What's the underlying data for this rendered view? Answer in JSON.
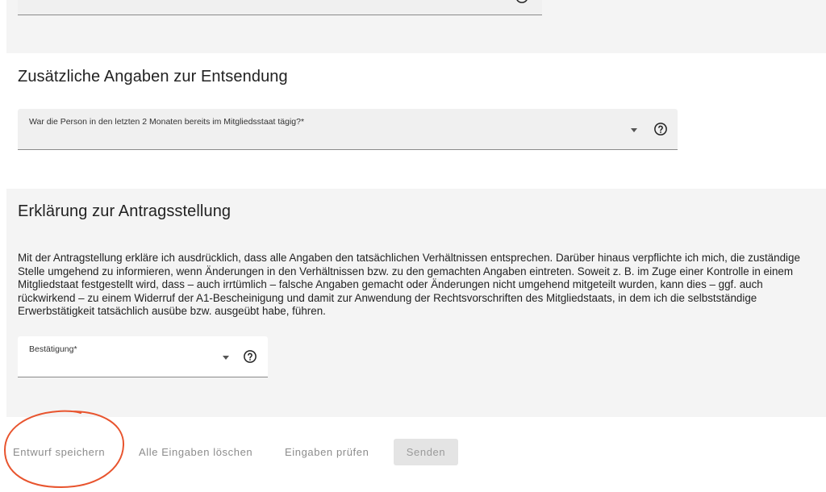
{
  "sections": {
    "entsendung": {
      "title": "Zusätzliche Angaben zur Entsendung",
      "field_label": "War die Person in den letzten 2 Monaten bereits im Mitgliedsstaat tägig?*"
    },
    "erklaerung": {
      "title": "Erklärung zur Antragsstellung",
      "text": "Mit der Antragstellung erkläre ich ausdrücklich, dass alle Angaben den tatsächlichen Verhältnissen entsprechen. Darüber hinaus verpflichte ich mich, die zuständige Stelle umgehend zu informieren, wenn Änderungen in den Verhältnissen bzw. zu den gemachten Angaben eintreten. Soweit z. B. im Zuge einer Kontrolle in einem Mitgliedstaat festgestellt wird, dass – auch irrtümlich – falsche Angaben gemacht oder Änderungen nicht umgehend mitgeteilt wurden, kann dies – ggf. auch rückwirkend – zu einem Widerruf der A1-Bescheinigung und damit zur Anwendung der Rechtsvorschriften des Mitgliedstaats, in dem ich die selbstständige Erwerbstätigkeit tatsächlich ausübe bzw. ausgeübt habe, führen.",
      "field_label": "Bestätigung*"
    }
  },
  "actions": {
    "draft": "Entwurf speichern",
    "clear": "Alle Eingaben löschen",
    "check": "Eingaben prüfen",
    "send": "Senden"
  },
  "icons": {
    "help": "help-circle-icon",
    "dropdown": "caret-down-icon"
  },
  "colors": {
    "section_bg": "#f4f4f4",
    "field_bg": "#f0f0f0",
    "annotation": "#e8542e"
  }
}
